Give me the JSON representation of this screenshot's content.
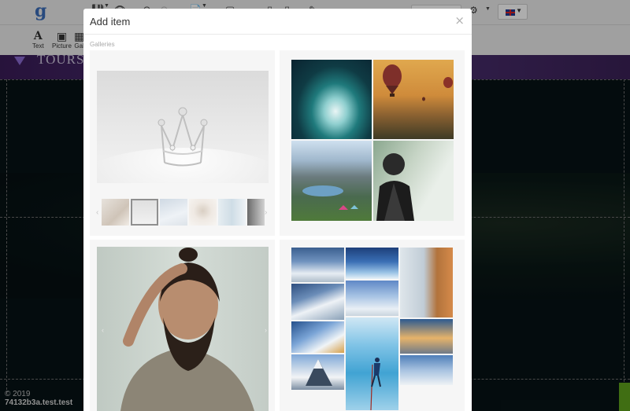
{
  "editor": {
    "tools": [
      {
        "label": "Text",
        "icon": "text-A-icon"
      },
      {
        "label": "Picture",
        "icon": "picture-icon"
      },
      {
        "label": "Gal",
        "icon": "gallery-icon"
      }
    ]
  },
  "site": {
    "brand_name": "TOURS",
    "copyright": "© 2019",
    "domain": "74132b3a.test.test"
  },
  "modal": {
    "title": "Add item",
    "close_symbol": "×",
    "section_label": "Galleries"
  },
  "galleries": [
    {
      "kind": "slider",
      "hero": "crown-photo",
      "thumbnails": 6,
      "active_thumbnail": 2
    },
    {
      "kind": "grid-2x2",
      "photos": [
        "ocean-wave",
        "hot-air-balloons",
        "mountain-lake-camp",
        "hiker-backpack"
      ]
    },
    {
      "kind": "single",
      "photos": [
        "man-portrait"
      ]
    },
    {
      "kind": "masonry",
      "photos": [
        "snow-ridge",
        "glacier-cave",
        "rock-arch-sunset",
        "alpine-peaks",
        "climber-summit",
        "ice-climber",
        "snow-expedition",
        "cairn-lake",
        "matterhorn",
        "snow-summit-hikers"
      ]
    }
  ],
  "colors": {
    "modal_background": "#ffffff",
    "card_background": "#f6f6f6",
    "header_band": "#51357a",
    "accent_green": "#5fa31d"
  }
}
